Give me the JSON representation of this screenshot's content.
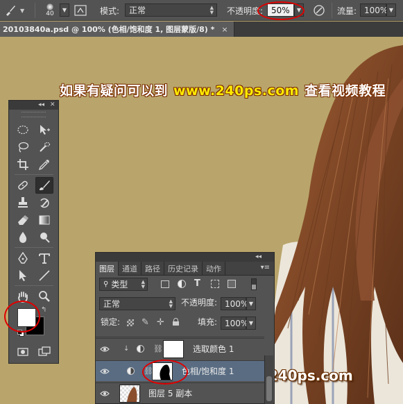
{
  "options_bar": {
    "brush_size": "40",
    "mode_label": "模式:",
    "mode_value": "正常",
    "opacity_label": "不透明度:",
    "opacity_value": "50%",
    "flow_label": "流量:",
    "flow_value": "100%"
  },
  "document_tab": {
    "title": "20103840a.psd @ 100% (色相/饱和度 1, 图层蒙版/8) *",
    "close_symbol": "×"
  },
  "canvas": {
    "banner_prefix": "如果有疑问可以到",
    "banner_url": "www.240ps.com",
    "banner_suffix": "查看视频教程",
    "watermark": "www.240ps.com"
  },
  "layers_panel": {
    "tabs": [
      "图层",
      "通道",
      "路径",
      "历史记录",
      "动作"
    ],
    "active_tab": 0,
    "filter_value": "类型",
    "blend_mode": "正常",
    "opacity_label": "不透明度:",
    "opacity_value": "100%",
    "lock_label": "锁定:",
    "fill_label": "填充:",
    "fill_value": "100%",
    "layers": [
      {
        "name": "选取颜色 1",
        "selected": false
      },
      {
        "name": "色相/饱和度 1",
        "selected": true
      },
      {
        "name": "图层 5 副本",
        "selected": false
      }
    ]
  },
  "colors": {
    "canvas_bg": "#b9a56b",
    "panel_bg": "#535353",
    "selection": "#596c82",
    "annotation": "#e00000"
  },
  "icons": [
    "brush-icon",
    "brush-preset-icon",
    "airbrush-icon",
    "pressure-icon",
    "marquee-icon",
    "move-icon",
    "lasso-icon",
    "quick-select-icon",
    "crop-icon",
    "eyedropper-icon",
    "healing-icon",
    "brush-tool-icon",
    "stamp-icon",
    "history-brush-icon",
    "eraser-icon",
    "gradient-icon",
    "blur-icon",
    "dodge-icon",
    "pen-icon",
    "type-icon",
    "path-select-icon",
    "line-icon",
    "hand-icon",
    "zoom-icon",
    "eye-icon",
    "link-icon",
    "adjustment-icon"
  ]
}
